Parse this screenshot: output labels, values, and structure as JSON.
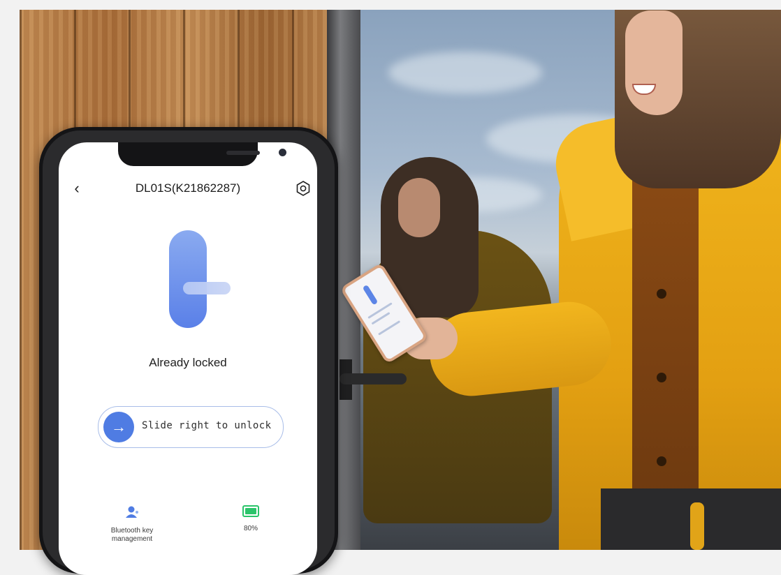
{
  "app": {
    "device_title": "DL01S(K21862287)",
    "lock_status": "Already locked",
    "slider_text": "Slide right to unlock",
    "slider_icon": "arrow-right-icon",
    "back_icon": "back-chevron-icon",
    "back_glyph": "‹",
    "settings_icon": "settings-icon",
    "features": [
      {
        "label": "Bluetooth key management",
        "icon": "user-key-icon"
      },
      {
        "label": "80%",
        "icon": "battery-icon"
      }
    ],
    "accent_color": "#4f7ce3",
    "battery_color": "#2bc46a",
    "battery_level": 0.8
  }
}
